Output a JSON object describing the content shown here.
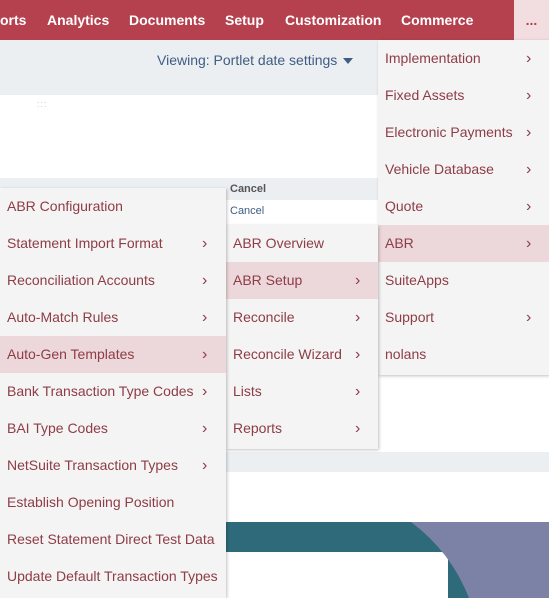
{
  "nav": {
    "items": [
      "orts",
      "Analytics",
      "Documents",
      "Setup",
      "Customization",
      "Commerce"
    ],
    "more": "..."
  },
  "header": {
    "viewing": "Viewing: Portlet date settings"
  },
  "page": {
    "grip": ":::",
    "cancel_header": "Cancel",
    "cancel_link": "Cancel"
  },
  "menus": {
    "main": [
      {
        "label": "Implementation",
        "has_sub": true
      },
      {
        "label": "Fixed Assets",
        "has_sub": true
      },
      {
        "label": "Electronic Payments",
        "has_sub": true
      },
      {
        "label": "Vehicle Database",
        "has_sub": true
      },
      {
        "label": "Quote",
        "has_sub": true
      },
      {
        "label": "ABR",
        "has_sub": true,
        "active": true
      },
      {
        "label": "SuiteApps",
        "has_sub": false
      },
      {
        "label": "Support",
        "has_sub": true
      },
      {
        "label": "nolans",
        "has_sub": false
      }
    ],
    "abr": [
      {
        "label": "ABR Overview",
        "has_sub": false
      },
      {
        "label": "ABR Setup",
        "has_sub": true,
        "active": true
      },
      {
        "label": "Reconcile",
        "has_sub": true
      },
      {
        "label": "Reconcile Wizard",
        "has_sub": true
      },
      {
        "label": "Lists",
        "has_sub": true
      },
      {
        "label": "Reports",
        "has_sub": true
      }
    ],
    "setup": [
      {
        "label": "ABR Configuration",
        "has_sub": false
      },
      {
        "label": "Statement Import Format",
        "has_sub": true
      },
      {
        "label": "Reconciliation Accounts",
        "has_sub": true
      },
      {
        "label": "Auto-Match Rules",
        "has_sub": true
      },
      {
        "label": "Auto-Gen Templates",
        "has_sub": true,
        "active": true
      },
      {
        "label": "Bank Transaction Type Codes",
        "has_sub": true
      },
      {
        "label": "BAI Type Codes",
        "has_sub": true
      },
      {
        "label": "NetSuite Transaction Types",
        "has_sub": true
      },
      {
        "label": "Establish Opening Position",
        "has_sub": false
      },
      {
        "label": "Reset Statement Direct Test Data",
        "has_sub": false
      },
      {
        "label": "Update Default Transaction Types",
        "has_sub": false
      }
    ]
  },
  "icons": {
    "chevron": "chevron-right-icon",
    "caret": "caret-down-icon"
  },
  "colors": {
    "brand": "#b5414f",
    "menu_text": "#8e3c46",
    "menu_active": "#ecd7da",
    "link": "#3f5c84"
  }
}
